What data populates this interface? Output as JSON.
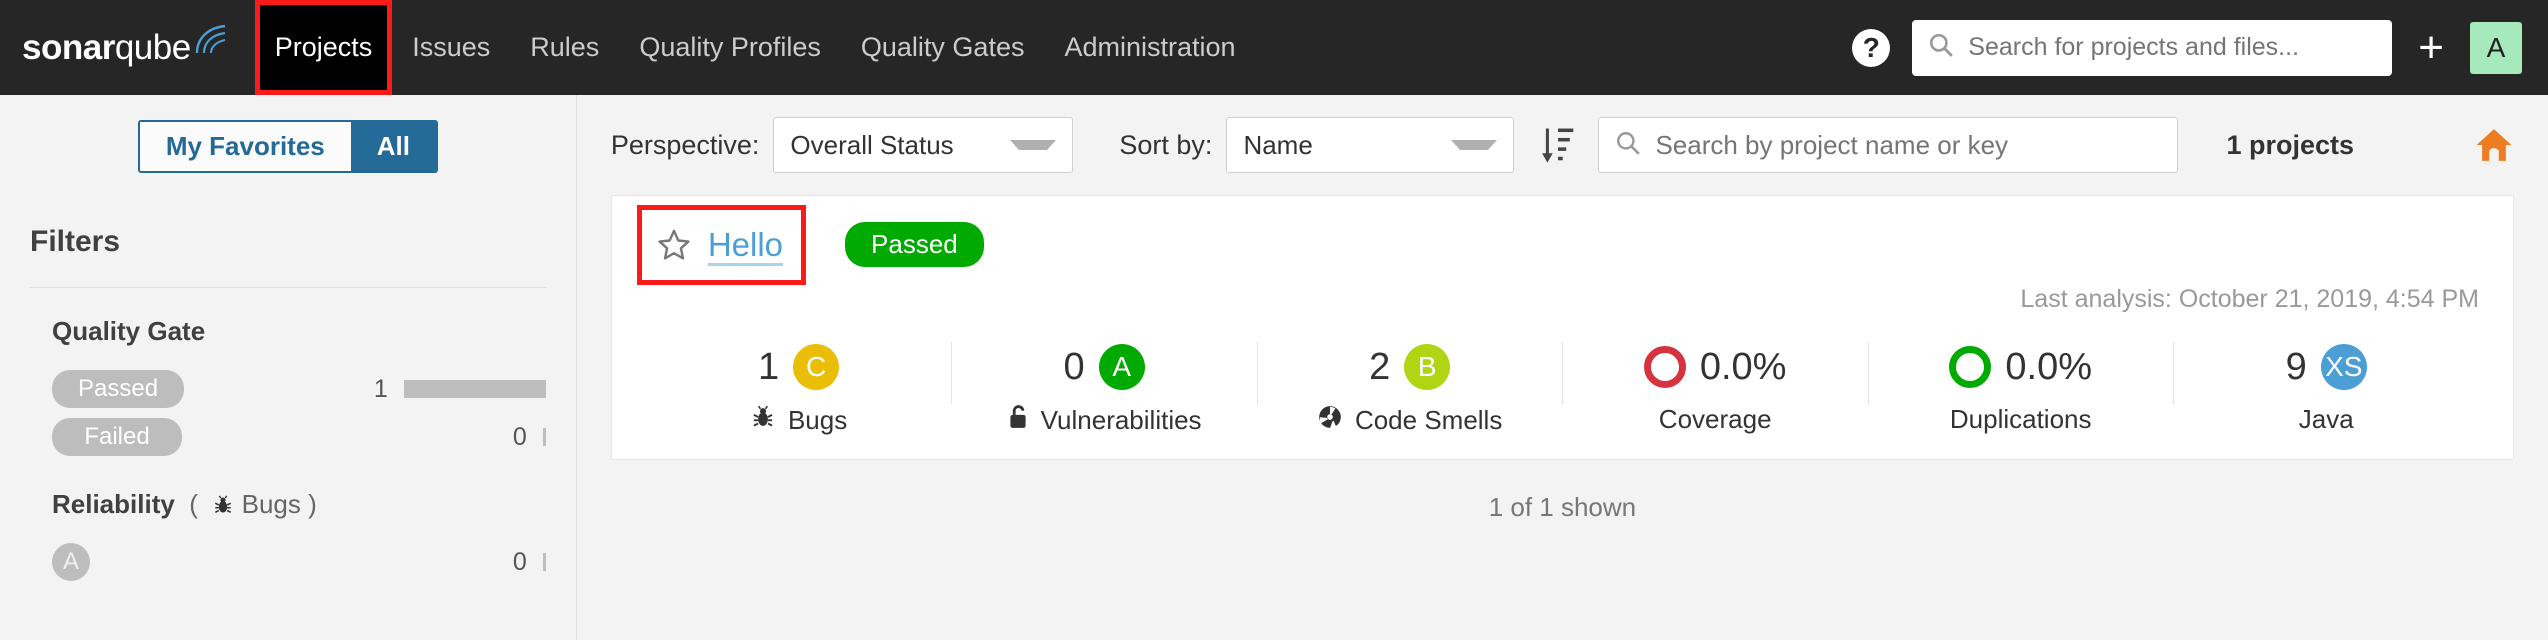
{
  "navbar": {
    "brand": {
      "bold": "sonar",
      "light": "qube"
    },
    "items": [
      {
        "label": "Projects",
        "active": true,
        "highlighted": true
      },
      {
        "label": "Issues",
        "active": false,
        "highlighted": false
      },
      {
        "label": "Rules",
        "active": false,
        "highlighted": false
      },
      {
        "label": "Quality Profiles",
        "active": false,
        "highlighted": false
      },
      {
        "label": "Quality Gates",
        "active": false,
        "highlighted": false
      },
      {
        "label": "Administration",
        "active": false,
        "highlighted": false
      }
    ],
    "help_icon": "help-icon",
    "search": {
      "placeholder": "Search for projects and files...",
      "value": "",
      "icon": "search-icon"
    },
    "plus_icon": "plus-icon",
    "avatar_initial": "A",
    "avatar_color": "#a6e9ba",
    "background_color": "#262626"
  },
  "sidebar": {
    "toggle": {
      "left_label": "My Favorites",
      "right_label": "All",
      "selected": "All",
      "accent_color": "#236a97"
    },
    "filters_title": "Filters",
    "facets": [
      {
        "title": "Quality Gate",
        "subtitle": "",
        "rows": [
          {
            "label": "Passed",
            "type": "pill",
            "count": "1",
            "bar": "full"
          },
          {
            "label": "Failed",
            "type": "pill",
            "count": "0",
            "bar": "empty"
          }
        ]
      },
      {
        "title": "Reliability",
        "subtitle": "( 🐞 Bugs )",
        "rows": [
          {
            "label": "A",
            "type": "circle",
            "count": "0",
            "bar": "empty"
          }
        ]
      }
    ]
  },
  "controls": {
    "perspective_label": "Perspective:",
    "perspective_value": "Overall Status",
    "sortby_label": "Sort by:",
    "sortby_value": "Name",
    "sort_direction_icon": "sort-descending-icon",
    "search": {
      "placeholder": "Search by project name or key",
      "value": "",
      "icon": "search-icon"
    },
    "project_count": "1 projects",
    "home_icon": "home-icon",
    "home_icon_color": "#ed7d20"
  },
  "project": {
    "favorite_icon": "star-outline-icon",
    "name": "Hello",
    "quality_gate": {
      "label": "Passed",
      "color": "#00aa00"
    },
    "last_analysis": "Last analysis: October 21, 2019, 4:54 PM",
    "measures": [
      {
        "value": "1",
        "rating": "C",
        "rating_class": "r-C",
        "icon": "bug-icon",
        "icon_glyph": "🐞",
        "label": "Bugs",
        "kind": "rating"
      },
      {
        "value": "0",
        "rating": "A",
        "rating_class": "r-A",
        "icon": "vulnerability-lock-icon",
        "icon_glyph": "🔓",
        "label": "Vulnerabilities",
        "kind": "rating"
      },
      {
        "value": "2",
        "rating": "B",
        "rating_class": "r-B",
        "icon": "code-smell-icon",
        "icon_glyph": "☢",
        "label": "Code Smells",
        "kind": "rating"
      },
      {
        "value": "0.0%",
        "donut": "red",
        "label": "Coverage",
        "kind": "donut"
      },
      {
        "value": "0.0%",
        "donut": "green",
        "label": "Duplications",
        "kind": "donut"
      },
      {
        "value": "9",
        "rating": "XS",
        "rating_class": "r-XS",
        "label": "Java",
        "kind": "size"
      }
    ]
  },
  "footer": {
    "shown_text": "1 of 1 shown"
  },
  "colors": {
    "rating_a": "#00aa00",
    "rating_b": "#b0d513",
    "rating_c": "#eabe06",
    "size_xs": "#4b9fd5",
    "coverage_red": "#d4333f",
    "link_blue": "#4b9fd5",
    "highlight_red": "#ff1a1a"
  }
}
